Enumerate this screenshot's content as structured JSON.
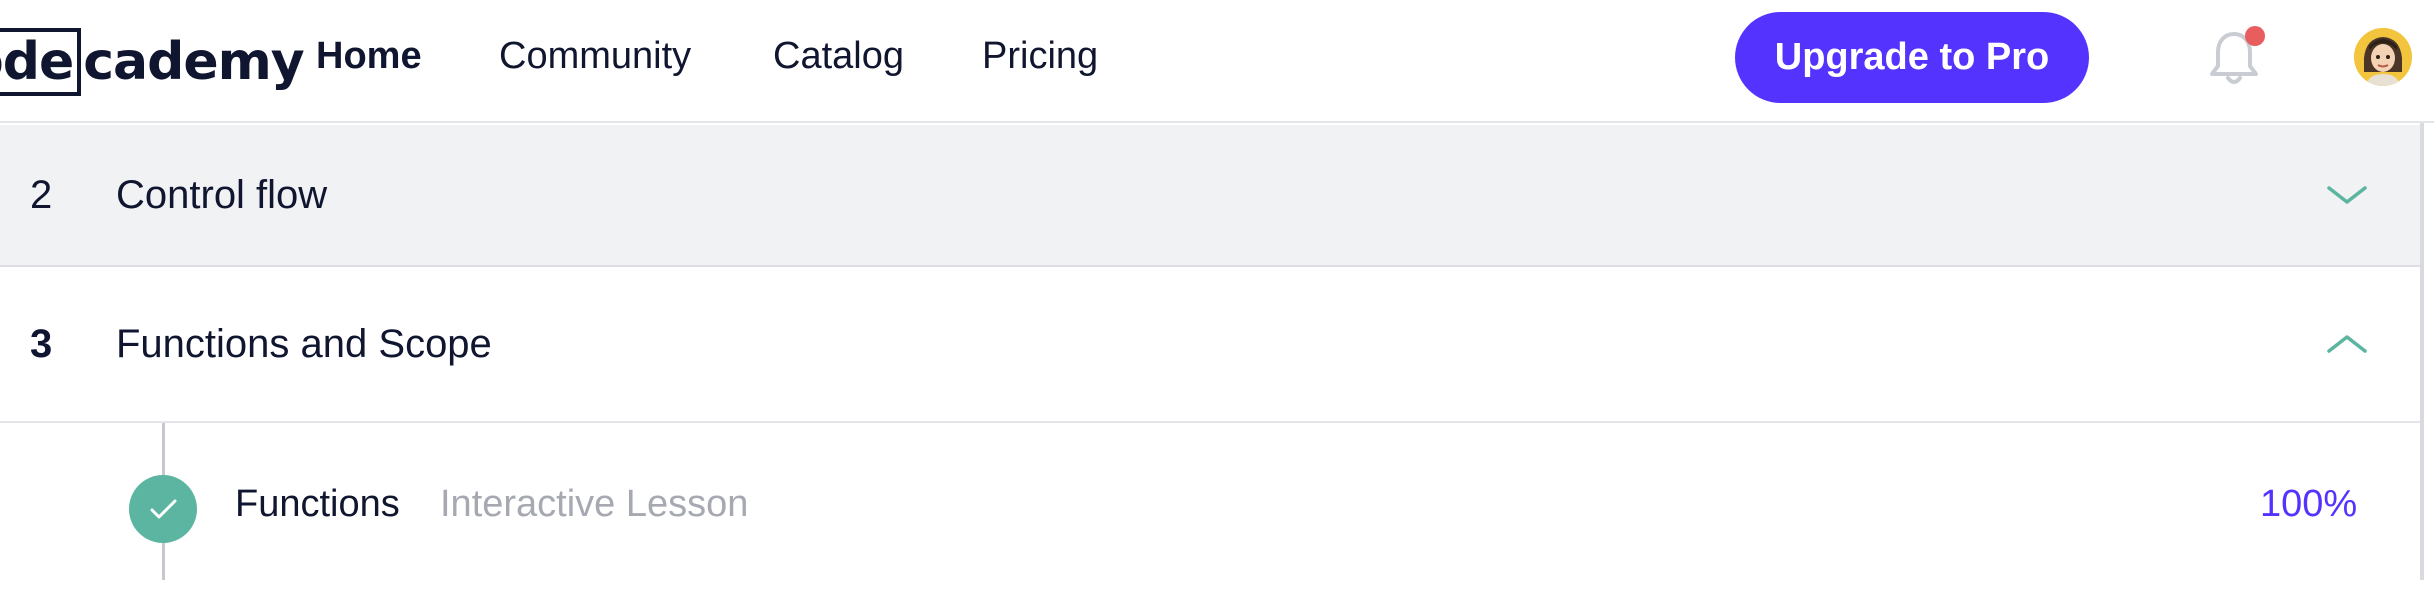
{
  "header": {
    "logo_prefix": "ode",
    "logo_suffix": "cademy",
    "nav": {
      "home": "Home",
      "community": "Community",
      "catalog": "Catalog",
      "pricing": "Pricing"
    },
    "upgrade_label": "Upgrade to Pro",
    "notification_icon": "bell-icon",
    "has_notification": true,
    "accent_color": "#5533ff"
  },
  "modules": [
    {
      "number": "2",
      "title": "Control flow",
      "expanded": false,
      "chevron": "chevron-down-icon"
    },
    {
      "number": "3",
      "title": "Functions and Scope",
      "expanded": true,
      "chevron": "chevron-up-icon"
    }
  ],
  "lessons": [
    {
      "title": "Functions",
      "type": "Interactive Lesson",
      "progress": "100%",
      "completed": true,
      "status_icon": "check-icon"
    }
  ],
  "colors": {
    "completed": "#5bb5a0",
    "progress_text": "#5533ff",
    "notification_dot": "#e85d5d"
  }
}
